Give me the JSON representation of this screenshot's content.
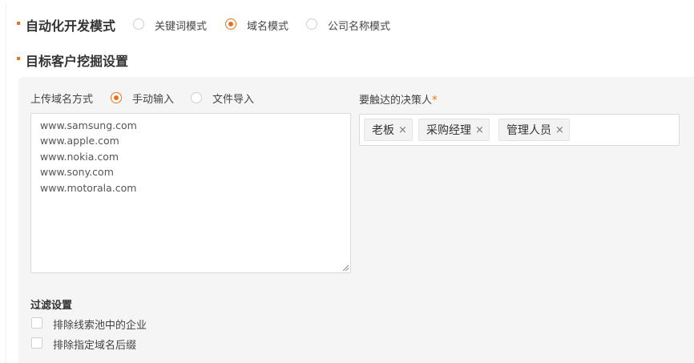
{
  "dev_mode": {
    "title": "自动化开发模式",
    "options": [
      {
        "label": "关键词模式",
        "checked": false
      },
      {
        "label": "域名模式",
        "checked": true
      },
      {
        "label": "公司名称模式",
        "checked": false
      }
    ]
  },
  "mining": {
    "title": "目标客户挖掘设置",
    "upload": {
      "label": "上传域名方式",
      "options": [
        {
          "label": "手动输入",
          "checked": true
        },
        {
          "label": "文件导入",
          "checked": false
        }
      ]
    },
    "domains": [
      "www.samsung.com",
      "www.apple.com",
      "www.nokia.com",
      "www.sony.com",
      "www.motorala.com"
    ],
    "decision_makers": {
      "label": "要触达的决策人",
      "required_mark": "*",
      "tags": [
        "老板",
        "采购经理",
        "管理人员"
      ],
      "remove_glyph": "×"
    },
    "filter": {
      "title": "过滤设置",
      "options": [
        {
          "label": "排除线索池中的企业",
          "checked": false
        },
        {
          "label": "排除指定域名后缀",
          "checked": false
        }
      ]
    }
  },
  "colors": {
    "accent": "#e8731f",
    "panel_bg": "#f5f5f5"
  }
}
